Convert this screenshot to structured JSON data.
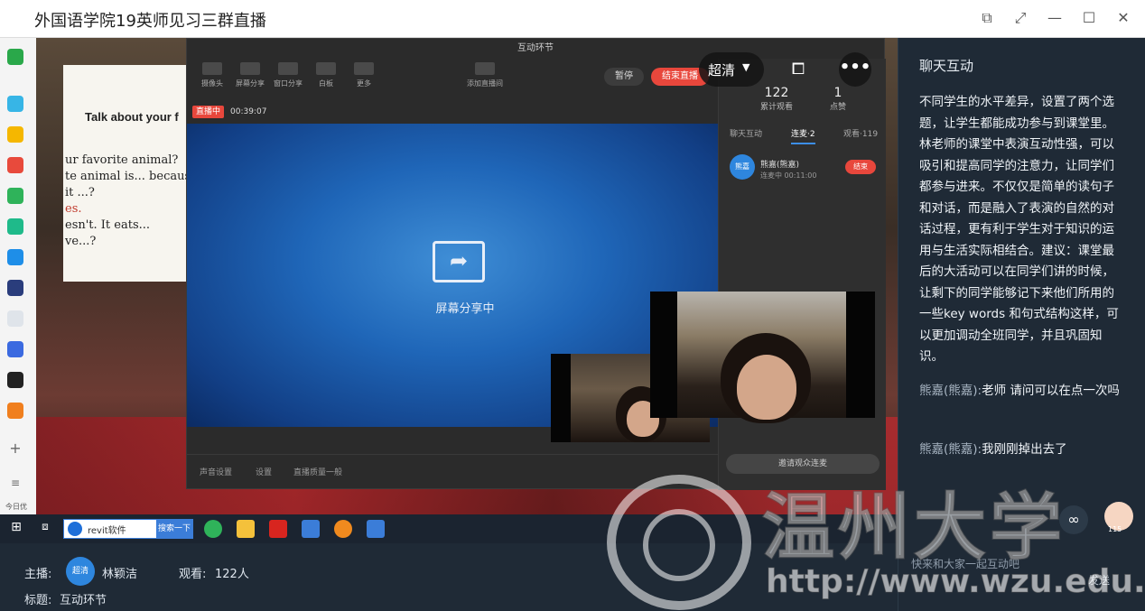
{
  "window": {
    "title": "外国语学院19英师见习三群直播",
    "controls": [
      "share-icon",
      "expand-icon",
      "minimize-icon",
      "maximize-icon",
      "close-icon"
    ]
  },
  "stream_window": {
    "title": "互动环节",
    "toolbar": [
      {
        "label": "摄像头",
        "icon": "camera-icon"
      },
      {
        "label": "屏幕分享",
        "icon": "screen-share-icon"
      },
      {
        "label": "窗口分享",
        "icon": "window-share-icon"
      },
      {
        "label": "白板",
        "icon": "whiteboard-icon"
      },
      {
        "label": "更多",
        "icon": "grid-icon"
      },
      {
        "label": "添加直播间",
        "icon": "add-room-icon"
      }
    ],
    "pause_label": "暂停",
    "end_live_label": "结束直播",
    "live_badge": "直播中",
    "live_time": "00:39:07",
    "share_status": "屏幕分享中",
    "stats": [
      {
        "value": "122",
        "label": "累计观看"
      },
      {
        "value": "1",
        "label": "点赞"
      }
    ],
    "tabs": [
      "聊天互动",
      "连麦·2",
      "观看·119"
    ],
    "guest": {
      "avatar": "熊嘉",
      "name": "熊嘉(熊嘉)",
      "status": "连麦中 00:11:00",
      "end_label": "结束"
    },
    "bottom": [
      "声音设置",
      "设置",
      "直播质量一般"
    ],
    "invite_label": "邀请观众连麦"
  },
  "slide": {
    "heading": "Talk about your f",
    "lines": [
      "ur favorite animal?",
      "te animal is... becaus",
      "it ...?",
      "es.",
      "esn't. It eats...",
      "ve...?"
    ]
  },
  "player": {
    "quality": "超清",
    "rotate_icon": "rotate-icon",
    "more_icon": "more-icon"
  },
  "taskbar": {
    "search_text": "revit软件",
    "search_button": "搜索一下",
    "today": "今日优"
  },
  "footer": {
    "anchor_label": "主播:",
    "anchor_avatar": "超清",
    "anchor_name": "林颖洁",
    "viewers_label": "观看:",
    "viewers_value": "122人",
    "subject_label": "标题:",
    "subject_value": "互动环节"
  },
  "chat": {
    "title": "聊天互动",
    "messages": [
      {
        "name": "",
        "text": "不同学生的水平差异，设置了两个选题，让学生都能成功参与到课堂里。林老师的课堂中表演互动性强，可以吸引和提高同学的注意力，让同学们都参与进来。不仅仅是简单的读句子和对话，而是融入了表演的自然的对话过程，更有利于学生对于知识的运用与生活实际相结合。建议：课堂最后的大活动可以在同学们讲的时候，让剩下的同学能够记下来他们所用的一些key words 和句式结构这样，可以更加调动全班同学，并且巩固知识。"
      },
      {
        "name": "熊嘉(熊嘉):",
        "text": "老师 请问可以在点一次吗"
      },
      {
        "name": "熊嘉(熊嘉):",
        "text": "我刚刚掉出去了"
      }
    ],
    "input_placeholder": "快来和大家一起互动吧",
    "send_label": "发送",
    "like_count": "115"
  },
  "watermark": {
    "text": "温州大学",
    "url": "http://www.wzu.edu.cn"
  },
  "colors": {
    "accent": "#2e86de",
    "danger": "#e8473c",
    "panel": "#1f2a36"
  }
}
